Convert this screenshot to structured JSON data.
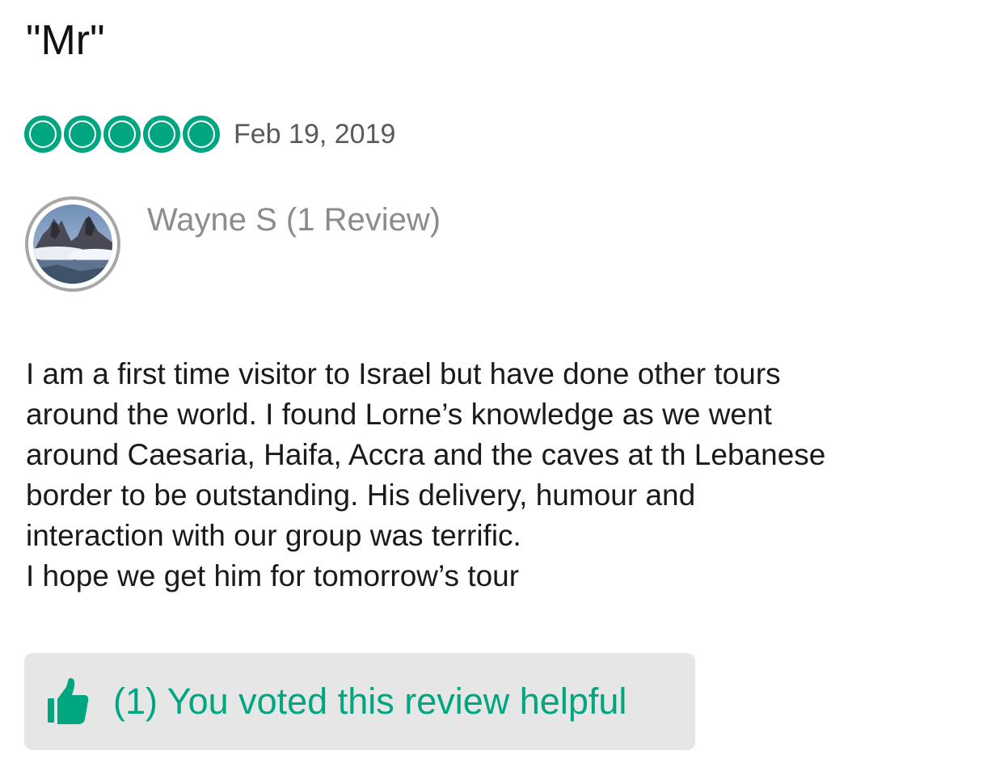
{
  "review": {
    "title": "\"Mr\"",
    "rating": {
      "value": 5,
      "max": 5,
      "icon": "rating-bubble-icon",
      "color": "#00a680"
    },
    "date": "Feb 19, 2019",
    "reviewer": {
      "name_line": "Wayne S (1 Review)",
      "avatar_icon": "mountain-photo-avatar"
    },
    "body": "I am a first time visitor to Israel but have done other tours\naround the world. I found Lorne’s knowledge as we went\naround Caesaria, Haifa, Accra and the caves at th Lebanese\nborder to be outstanding. His delivery, humour and\ninteraction with our group was terrific.\nI hope we get him for tomorrow’s tour",
    "helpful": {
      "label": "(1) You voted this review helpful",
      "icon": "thumbs-up-icon",
      "color": "#00a680",
      "background": "#e6e6e6"
    }
  }
}
